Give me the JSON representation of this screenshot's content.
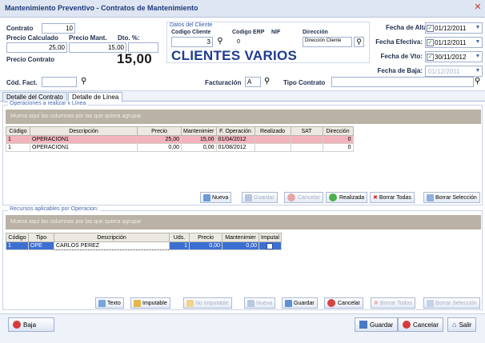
{
  "window": {
    "title": "Mantenimiento Preventivo - Contratos de Mantenimiento"
  },
  "header": {
    "contrato_label": "Contrato",
    "contrato_value": "10",
    "precio_calc_label": "Precio Calculado",
    "precio_calc_value": "25,00",
    "precio_mant_label": "Precio Mant.",
    "precio_mant_value": "15,00",
    "dto_label": "Dto. %:",
    "dto_value": "",
    "precio_contrato_label": "Precio Contrato",
    "precio_contrato_value": "15,00",
    "cliente_box_label": "Datos del Cliente",
    "codigo_cliente_label": "Codigo Cliente",
    "codigo_cliente_value": "3",
    "codigo_erp_label": "Codigo ERP",
    "codigo_erp_value": "0",
    "nif_label": "NIF",
    "direccion_label": "Dirección",
    "direccion_value": "Dirección Cliente",
    "cliente_nombre": "CLIENTES VARIOS",
    "fecha_alta_label": "Fecha de Alta:",
    "fecha_alta_value": "01/12/2011",
    "fecha_efectiva_label": "Fecha Efectiva:",
    "fecha_efectiva_value": "01/12/2011",
    "fecha_vto_label": "Fecha de Vto:",
    "fecha_vto_value": "30/11/2012",
    "fecha_baja_label": "Fecha de Baja:",
    "fecha_baja_value": "01/12/2011",
    "cod_fact_label": "Cód. Fact.",
    "cod_fact_value": "",
    "facturacion_label": "Facturación",
    "facturacion_value": "A",
    "tipo_contrato_label": "Tipo Contrato",
    "tipo_contrato_value": ""
  },
  "tabs": [
    {
      "label": "Detalle del Contrato"
    },
    {
      "label": "Detalle de Línea"
    }
  ],
  "operaciones": {
    "section_label": "Operaciones a realizar x Línea",
    "group_hint": "Mueva aquí las columnas por las que quiera agrupar",
    "columns": [
      "Código",
      "Descripción",
      "Precio",
      "Mantenimier",
      "F. Operación",
      "Realizado",
      "SAT",
      "Dirección"
    ],
    "rows": [
      [
        "1",
        "OPERACION1",
        "25,00",
        "15,00",
        "01/04/2012",
        "",
        "",
        "0"
      ],
      [
        "1",
        "OPERACION1",
        "0,00",
        "0,00",
        "01/08/2012",
        "",
        "",
        "0"
      ]
    ],
    "buttons": {
      "nueva": "Nueva",
      "guardar": "Guardar",
      "cancelar": "Cancelar",
      "realizada": "Realizada",
      "borrar_todas": "Borrar Todas",
      "borrar_seleccion": "Borrar Selección"
    }
  },
  "recursos": {
    "section_label": "Recursos aplicables por Operacion:",
    "group_hint": "Mueva aquí las columnas por las que quiera agrupar",
    "columns": [
      "Código",
      "Tipo",
      "Descripción",
      "Uds.",
      "Precio",
      "Mantenimier",
      "Imputal"
    ],
    "rows": [
      [
        "1",
        "OPE",
        "CARLOS PEREZ",
        "1",
        "0,00",
        "0,00",
        ""
      ]
    ],
    "buttons": {
      "texto": "Texto",
      "imputable": "Imputable",
      "no_imputable": "No Imputable",
      "nueva": "Nueva",
      "guardar": "Guardar",
      "cancelar": "Cancelar",
      "borrar_todos": "Borrar Todos",
      "borrar_seleccion": "Borrar Selección"
    }
  },
  "footer": {
    "baja": "Baja",
    "guardar": "Guardar",
    "cancelar": "Cancelar",
    "salir": "Salir"
  },
  "colors": {
    "accent": "#1f3b8f",
    "row_selected": "#3c6fd1",
    "row_highlight": "#f3b3bd",
    "group_bar": "#b9b2a5"
  }
}
